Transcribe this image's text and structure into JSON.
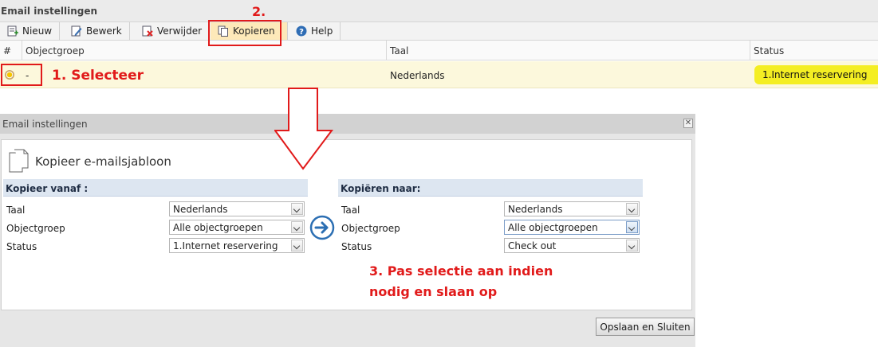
{
  "panel": {
    "title": "Email instellingen"
  },
  "toolbar": {
    "new_label": "Nieuw",
    "edit_label": "Bewerk",
    "delete_label": "Verwijder",
    "copy_label": "Kopieren",
    "help_label": "Help"
  },
  "grid": {
    "headers": {
      "num": "#",
      "objectgroup": "Objectgroep",
      "language": "Taal",
      "status": "Status"
    },
    "row": {
      "objectgroup": "-",
      "language": "Nederlands",
      "status": "1.Internet reservering"
    }
  },
  "annotations": {
    "step1": "1. Selecteer",
    "step2": "2.",
    "step3_line1": "3. Pas selectie aan indien",
    "step3_line2": "nodig en slaan op"
  },
  "dialog": {
    "title": "Email instellingen",
    "heading": "Kopieer e-mailsjabloon",
    "from": {
      "header": "Kopieer vanaf :",
      "language_label": "Taal",
      "language_value": "Nederlands",
      "objectgroup_label": "Objectgroep",
      "objectgroup_value": "Alle objectgroepen",
      "status_label": "Status",
      "status_value": "1.Internet reservering"
    },
    "to": {
      "header": "Kopiëren naar:",
      "language_label": "Taal",
      "language_value": "Nederlands",
      "objectgroup_label": "Objectgroep",
      "objectgroup_value": "Alle objectgroepen",
      "status_label": "Status",
      "status_value": "Check out"
    },
    "save_close_label": "Opslaan en Sluiten"
  },
  "colors": {
    "selected_row": "#fcf8dc",
    "status_badge": "#f4ee23",
    "annotation_red": "#e11a1a",
    "section_header": "#dde6f1",
    "arrow_blue": "#2c6fb3"
  }
}
